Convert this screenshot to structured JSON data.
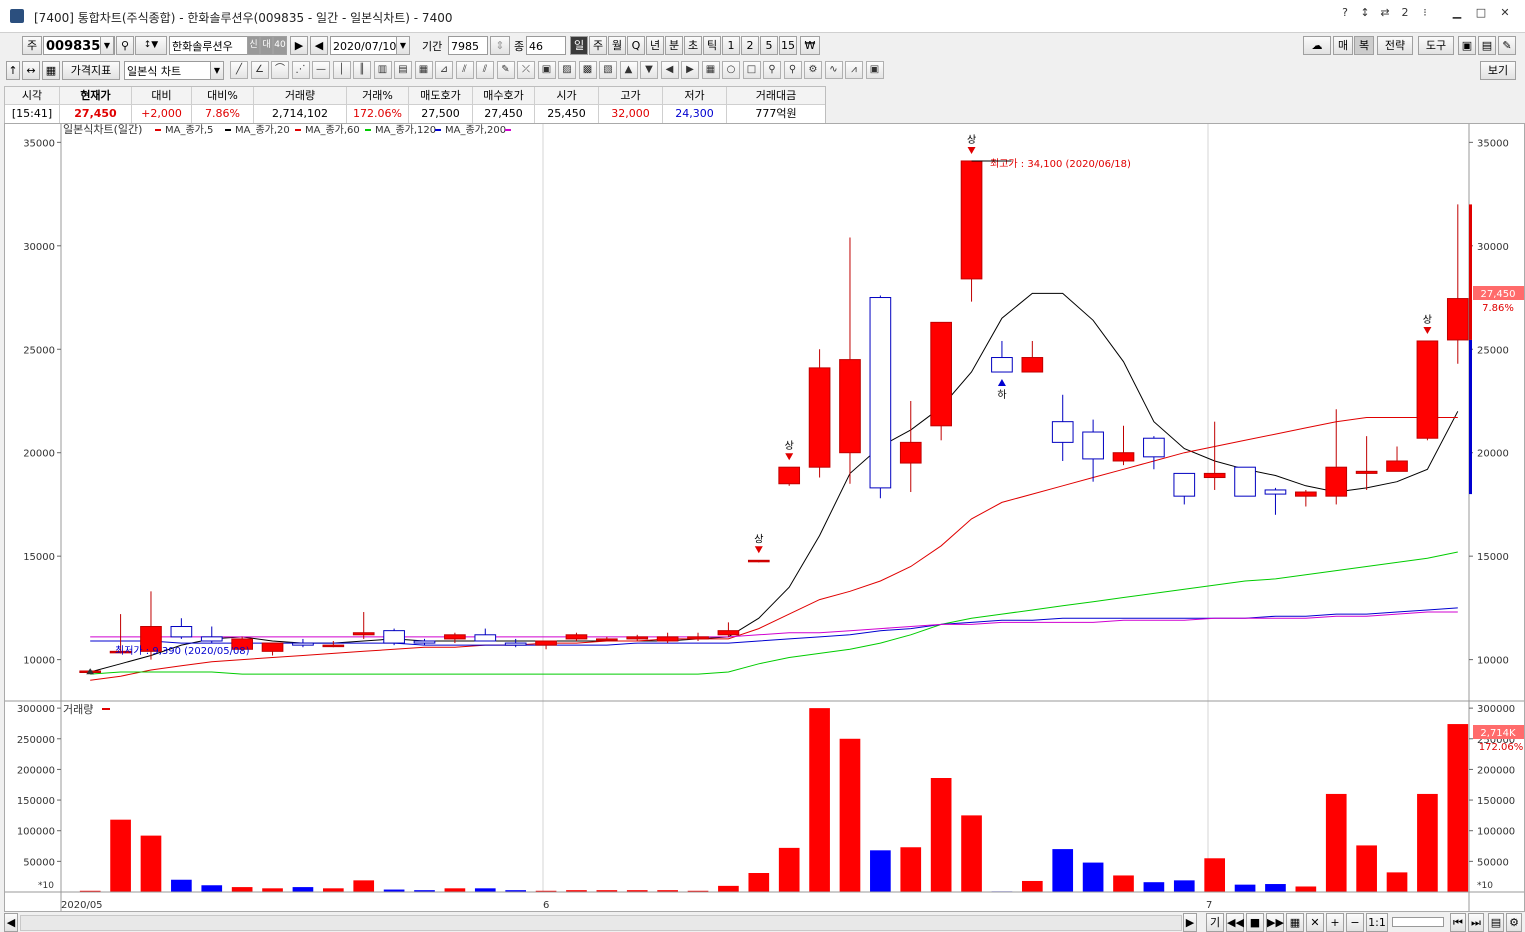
{
  "window": {
    "title": "[7400] 통합차트(주식종합) - 한화솔루션우(009835 - 일간 - 일본식차트) - 7400",
    "controls": [
      "?",
      "↕",
      "⇄",
      "2",
      "⁝"
    ]
  },
  "toolbar1": {
    "market": "주",
    "code": "009835",
    "name": "한화솔루션우",
    "badges": [
      "신",
      "대",
      "40"
    ],
    "date": "2020/07/10",
    "period_label": "기간",
    "period_value": "7985",
    "count_label": "종",
    "count_value": "46",
    "intervals": [
      "일",
      "주",
      "월",
      "Q",
      "년",
      "분",
      "초",
      "틱",
      "1",
      "2",
      "5",
      "15",
      "₩"
    ],
    "selected_interval": "일",
    "right_buttons": [
      "매",
      "복",
      "전략",
      "도구"
    ]
  },
  "toolbar2": {
    "indicator_label": "가격지표",
    "chart_type": "일본식 차트",
    "view_button": "보기"
  },
  "quote": {
    "headers": [
      "시각",
      "현재가",
      "대비",
      "대비%",
      "거래량",
      "거래%",
      "매도호가",
      "매수호가",
      "시가",
      "고가",
      "저가",
      "거래대금"
    ],
    "values": [
      "[15:41]",
      "27,450",
      "+2,000",
      "7.86%",
      "2,714,102",
      "172.06%",
      "27,500",
      "27,450",
      "25,450",
      "32,000",
      "24,300",
      "777억원"
    ]
  },
  "chart": {
    "legend_title": "일본식차트(일간)",
    "ma_legends": [
      "MA_종가,5",
      "MA_종가,20",
      "MA_종가,60",
      "MA_종가,120",
      "MA_종가,200"
    ],
    "high_annotation": "최고가 : 34,100 (2020/06/18)",
    "low_annotation": "최저가 : 9,390 (2020/05/08)",
    "price_tag": "27,450",
    "pct_tag": "7.86%",
    "volume_legend": "거래량",
    "vol_tag": "2,714K",
    "vol_pct_tag": "172.06%",
    "vol_unit": "*10",
    "x_labels": [
      "2020/05",
      "6",
      "7"
    ],
    "marks": {
      "up": "상",
      "down": "하"
    },
    "bottom_controls": [
      "기",
      "1:1"
    ]
  },
  "chart_data": {
    "type": "candlestick",
    "ylim": [
      8000,
      35500
    ],
    "yticks": [
      10000,
      15000,
      20000,
      25000,
      30000,
      35000
    ],
    "volume_ylim": [
      0,
      310000
    ],
    "volume_ticks": [
      50000,
      100000,
      150000,
      200000,
      250000,
      300000
    ],
    "candles": [
      {
        "o": 9400,
        "h": 9500,
        "l": 9390,
        "c": 9450,
        "v": 2000
      },
      {
        "o": 10400,
        "h": 12200,
        "l": 10300,
        "c": 10400,
        "v": 118000
      },
      {
        "o": 10400,
        "h": 13300,
        "l": 10000,
        "c": 11600,
        "v": 92000
      },
      {
        "o": 11600,
        "h": 12000,
        "l": 11000,
        "c": 11100,
        "v": 20000
      },
      {
        "o": 11100,
        "h": 11600,
        "l": 10800,
        "c": 10900,
        "v": 11000
      },
      {
        "o": 10500,
        "h": 11100,
        "l": 10400,
        "c": 11000,
        "v": 8000
      },
      {
        "o": 10400,
        "h": 10800,
        "l": 10200,
        "c": 10800,
        "v": 6000
      },
      {
        "o": 10800,
        "h": 11000,
        "l": 10600,
        "c": 10700,
        "v": 8000
      },
      {
        "o": 10700,
        "h": 10900,
        "l": 10600,
        "c": 10700,
        "v": 6000
      },
      {
        "o": 11200,
        "h": 12300,
        "l": 11000,
        "c": 11300,
        "v": 19000
      },
      {
        "o": 11400,
        "h": 11500,
        "l": 10700,
        "c": 10800,
        "v": 4000
      },
      {
        "o": 10900,
        "h": 11000,
        "l": 10700,
        "c": 10800,
        "v": 3000
      },
      {
        "o": 11000,
        "h": 11300,
        "l": 10800,
        "c": 11200,
        "v": 6000
      },
      {
        "o": 11200,
        "h": 11500,
        "l": 10900,
        "c": 10900,
        "v": 6000
      },
      {
        "o": 10800,
        "h": 11000,
        "l": 10600,
        "c": 10700,
        "v": 3000
      },
      {
        "o": 10700,
        "h": 10900,
        "l": 10500,
        "c": 10900,
        "v": 2000
      },
      {
        "o": 11000,
        "h": 11300,
        "l": 10900,
        "c": 11200,
        "v": 3000
      },
      {
        "o": 11000,
        "h": 11100,
        "l": 10900,
        "c": 11000,
        "v": 3000
      },
      {
        "o": 11000,
        "h": 11200,
        "l": 10900,
        "c": 11100,
        "v": 3000
      },
      {
        "o": 10900,
        "h": 11300,
        "l": 10800,
        "c": 11100,
        "v": 3000
      },
      {
        "o": 11000,
        "h": 11300,
        "l": 10900,
        "c": 11100,
        "v": 2000
      },
      {
        "o": 11200,
        "h": 11800,
        "l": 11100,
        "c": 11400,
        "v": 10000
      },
      {
        "o": 14800,
        "h": 14800,
        "l": 14700,
        "c": 14800,
        "v": 31000
      },
      {
        "o": 18500,
        "h": 19300,
        "l": 18400,
        "c": 19300,
        "v": 72000
      },
      {
        "o": 19300,
        "h": 25000,
        "l": 18800,
        "c": 24100,
        "v": 300000
      },
      {
        "o": 20000,
        "h": 30400,
        "l": 18500,
        "c": 24500,
        "v": 250000
      },
      {
        "o": 27500,
        "h": 27600,
        "l": 17800,
        "c": 18300,
        "v": 68000
      },
      {
        "o": 19500,
        "h": 22500,
        "l": 18100,
        "c": 20500,
        "v": 73000
      },
      {
        "o": 21300,
        "h": 26200,
        "l": 20600,
        "c": 26300,
        "v": 186000
      },
      {
        "o": 28400,
        "h": 34100,
        "l": 27300,
        "c": 34100,
        "v": 125000
      },
      {
        "o": 24600,
        "h": 25400,
        "l": 23900,
        "c": 23900,
        "v": 1000
      },
      {
        "o": 23900,
        "h": 25400,
        "l": 23900,
        "c": 24600,
        "v": 18000
      },
      {
        "o": 21500,
        "h": 22800,
        "l": 19600,
        "c": 20500,
        "v": 70000
      },
      {
        "o": 21000,
        "h": 21600,
        "l": 18600,
        "c": 19700,
        "v": 48000
      },
      {
        "o": 19600,
        "h": 21300,
        "l": 19400,
        "c": 20000,
        "v": 27000
      },
      {
        "o": 20700,
        "h": 20800,
        "l": 19200,
        "c": 19800,
        "v": 16000
      },
      {
        "o": 19000,
        "h": 19000,
        "l": 17500,
        "c": 17900,
        "v": 19000
      },
      {
        "o": 18800,
        "h": 21500,
        "l": 18200,
        "c": 19000,
        "v": 55000
      },
      {
        "o": 19300,
        "h": 19300,
        "l": 17900,
        "c": 17900,
        "v": 12000
      },
      {
        "o": 18200,
        "h": 18300,
        "l": 17000,
        "c": 18000,
        "v": 13000
      },
      {
        "o": 17900,
        "h": 18200,
        "l": 17400,
        "c": 18100,
        "v": 9000
      },
      {
        "o": 17900,
        "h": 22100,
        "l": 17500,
        "c": 19300,
        "v": 160000
      },
      {
        "o": 19000,
        "h": 20800,
        "l": 18200,
        "c": 19100,
        "v": 76000
      },
      {
        "o": 19100,
        "h": 20300,
        "l": 19100,
        "c": 19600,
        "v": 32000
      },
      {
        "o": 20700,
        "h": 25400,
        "l": 20600,
        "c": 25400,
        "v": 160000
      },
      {
        "o": 25450,
        "h": 32000,
        "l": 24300,
        "c": 27450,
        "v": 274000
      }
    ],
    "ma5": [
      9400,
      9800,
      10200,
      10700,
      11000,
      11100,
      10900,
      10800,
      10800,
      10900,
      11000,
      10900,
      10900,
      10900,
      10900,
      10900,
      10900,
      10900,
      10900,
      10900,
      11000,
      11100,
      12000,
      13500,
      16000,
      19000,
      20300,
      21100,
      22200,
      23900,
      26500,
      27700,
      27700,
      26400,
      24400,
      21500,
      20200,
      19600,
      19200,
      18900,
      18400,
      18100,
      18300,
      18600,
      19200,
      22000
    ],
    "ma20": [
      9000,
      9200,
      9500,
      9700,
      9900,
      10000,
      10100,
      10200,
      10300,
      10400,
      10500,
      10600,
      10600,
      10700,
      10700,
      10800,
      10800,
      10900,
      10900,
      11000,
      11000,
      11000,
      11500,
      12200,
      12900,
      13300,
      13800,
      14500,
      15500,
      16800,
      17600,
      18000,
      18400,
      18800,
      19200,
      19600,
      20000,
      20300,
      20600,
      20900,
      21200,
      21500,
      21700,
      21700,
      21700,
      21700
    ],
    "ma60": [
      9300,
      9400,
      9400,
      9400,
      9400,
      9300,
      9300,
      9300,
      9300,
      9300,
      9300,
      9300,
      9300,
      9300,
      9300,
      9300,
      9300,
      9300,
      9300,
      9300,
      9300,
      9400,
      9800,
      10100,
      10300,
      10500,
      10800,
      11200,
      11700,
      12000,
      12200,
      12400,
      12600,
      12800,
      13000,
      13200,
      13400,
      13600,
      13800,
      13900,
      14100,
      14300,
      14500,
      14700,
      14900,
      15200
    ],
    "ma120": [
      10900,
      10900,
      10900,
      10800,
      10800,
      10800,
      10800,
      10800,
      10800,
      10800,
      10800,
      10700,
      10700,
      10700,
      10700,
      10700,
      10700,
      10700,
      10800,
      10800,
      10800,
      10800,
      10900,
      11000,
      11100,
      11200,
      11400,
      11500,
      11700,
      11800,
      11900,
      11900,
      12000,
      12000,
      12000,
      12000,
      12000,
      12000,
      12000,
      12100,
      12100,
      12200,
      12200,
      12300,
      12400,
      12500
    ],
    "ma200": [
      11100,
      11100,
      11100,
      11100,
      11100,
      11100,
      11100,
      11100,
      11100,
      11100,
      11100,
      11100,
      11100,
      11100,
      11100,
      11100,
      11100,
      11100,
      11100,
      11100,
      11100,
      11100,
      11200,
      11300,
      11300,
      11400,
      11500,
      11600,
      11700,
      11700,
      11800,
      11800,
      11800,
      11800,
      11900,
      11900,
      11900,
      12000,
      12000,
      12000,
      12000,
      12100,
      12100,
      12200,
      12300,
      12300
    ],
    "ma_colors": [
      "#000000",
      "#e00000",
      "#00cc00",
      "#0000d0",
      "#d000d0"
    ]
  }
}
